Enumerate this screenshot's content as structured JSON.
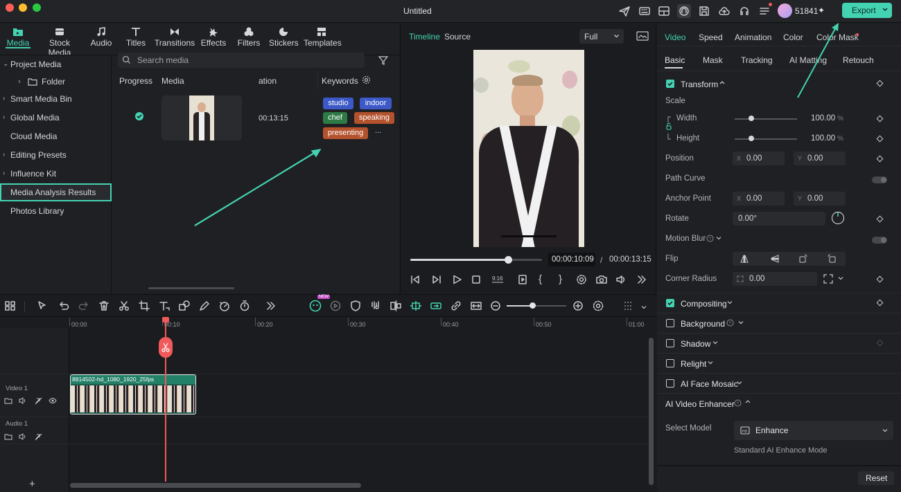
{
  "window": {
    "title": "Untitled",
    "credits": "51841",
    "export_label": "Export"
  },
  "colors": {
    "accent": "#43d3b2",
    "playhead": "#f05a5a",
    "export_bg": "#43d3b2",
    "tag_blue": "#3c59c7",
    "tag_green": "#2d7a45",
    "tag_orange": "#b4522e"
  },
  "library_tabs": [
    {
      "label": "Media",
      "icon": "media-folder-icon",
      "active": true
    },
    {
      "label": "Stock Media",
      "icon": "stock-media-icon"
    },
    {
      "label": "Audio",
      "icon": "music-note-icon"
    },
    {
      "label": "Titles",
      "icon": "text-t-icon"
    },
    {
      "label": "Transitions",
      "icon": "transition-bowtie-icon"
    },
    {
      "label": "Effects",
      "icon": "effects-star-icon"
    },
    {
      "label": "Filters",
      "icon": "filters-icon"
    },
    {
      "label": "Stickers",
      "icon": "sticker-icon"
    },
    {
      "label": "Templates",
      "icon": "templates-grid-icon"
    }
  ],
  "sidebar": [
    {
      "label": "Project Media",
      "expanded": true
    },
    {
      "label": "Folder",
      "child": true
    },
    {
      "label": "Smart Media Bin"
    },
    {
      "label": "Global Media"
    },
    {
      "label": "Cloud Media"
    },
    {
      "label": "Editing Presets"
    },
    {
      "label": "Influence Kit"
    },
    {
      "label": "Media Analysis Results",
      "selected": true
    },
    {
      "label": "Photos Library"
    }
  ],
  "media": {
    "search_placeholder": "Search media",
    "columns": [
      "Progress",
      "Media",
      "ation",
      "Keywords"
    ],
    "row": {
      "duration": "00:13:15",
      "keywords": [
        "studio",
        "indoor",
        "chef",
        "speaking",
        "presenting"
      ],
      "more": "..."
    }
  },
  "preview": {
    "tabs": [
      "Timeline",
      "Source"
    ],
    "zoom": "Full",
    "current_time": "00:00:10:09",
    "separator": "/",
    "total_time": "00:00:13:15",
    "progress": 0.74
  },
  "props": {
    "tabs": [
      "Video",
      "Speed",
      "Animation",
      "Color",
      "Color Mask"
    ],
    "subtabs": [
      "Basic",
      "Mask",
      "Tracking",
      "AI Matting",
      "Retouch"
    ],
    "transform": "Transform",
    "scale": "Scale",
    "width_label": "Width",
    "width_value": "100.00",
    "height_label": "Height",
    "height_value": "100.00",
    "pct": "%",
    "position": "Position",
    "pos_x": "0.00",
    "pos_y": "0.00",
    "path_curve": "Path Curve",
    "anchor_point": "Anchor Point",
    "anchor_x": "0.00",
    "anchor_y": "0.00",
    "x_label": "X",
    "y_label": "Y",
    "rotate": "Rotate",
    "rotate_value": "0.00°",
    "motion_blur": "Motion Blur",
    "flip": "Flip",
    "corner_radius": "Corner Radius",
    "corner_value": "0.00",
    "compositing": "Compositing",
    "background": "Background",
    "shadow": "Shadow",
    "relight": "Relight",
    "ai_face_mosaic": "AI Face Mosaic",
    "ai_video_enhancer": "AI Video Enhancer",
    "select_model": "Select Model",
    "model_value": "Enhance",
    "model_desc": "Standard AI Enhance Mode",
    "reset": "Reset"
  },
  "timeline": {
    "ruler": [
      "00:00",
      "00:10",
      "00:20",
      "00:30",
      "00:40",
      "00:50",
      "01:00"
    ],
    "tracks": [
      {
        "name": "Video 1"
      },
      {
        "name": "Audio 1"
      }
    ],
    "clip_name": "8814502-hd_1080_1920_25fps",
    "new_badge": "NEW",
    "add": "+"
  }
}
